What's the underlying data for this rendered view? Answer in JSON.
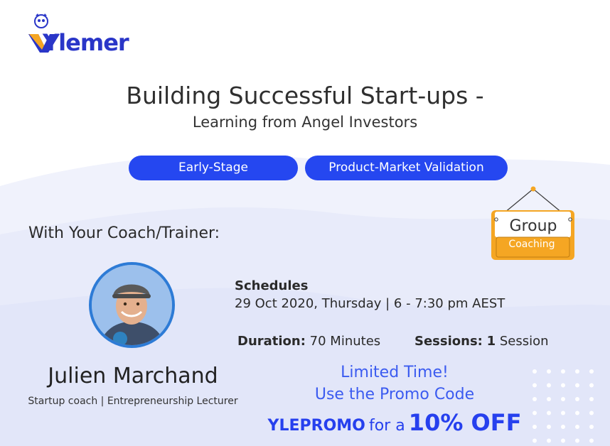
{
  "brand": {
    "name": "Ylemer"
  },
  "title": {
    "line1": "Building Successful Start-ups -",
    "line2": "Learning from Angel Investors"
  },
  "tags": [
    "Early-Stage",
    "Product-Market Validation"
  ],
  "coach": {
    "heading": "With Your Coach/Trainer:",
    "name": "Julien Marchand",
    "role": "Startup coach | Entrepreneurship Lecturer"
  },
  "schedule": {
    "label": "Schedules",
    "value": "29 Oct 2020, Thursday | 6 - 7:30 pm AEST"
  },
  "duration": {
    "label": "Duration:",
    "value": "70 Minutes"
  },
  "sessions": {
    "label": "Sessions:",
    "count": "1",
    "unit": "Session"
  },
  "sign": {
    "line1": "Group",
    "line2": "Coaching"
  },
  "promo": {
    "line1": "Limited Time!",
    "line2": "Use the Promo Code",
    "code": "YLEPROMO",
    "mid": "for a",
    "discount": "10% OFF"
  },
  "colors": {
    "accent": "#2547f0",
    "sign": "#f5a623",
    "wave": "#eef0fb"
  }
}
